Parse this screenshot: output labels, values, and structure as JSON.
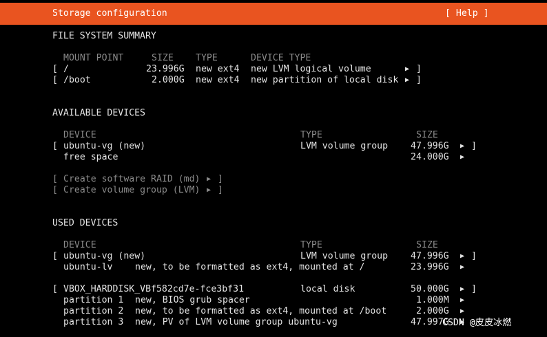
{
  "header": {
    "title": "Storage configuration",
    "help": "[ Help ]",
    "color": "#e95420"
  },
  "fs_summary": {
    "heading": "FILE SYSTEM SUMMARY",
    "columns": [
      "MOUNT POINT",
      "SIZE",
      "TYPE",
      "DEVICE TYPE"
    ],
    "rows": [
      {
        "mount": "/",
        "size": "23.996G",
        "type": "new ext4",
        "device_type": "new LVM logical volume"
      },
      {
        "mount": "/boot",
        "size": "2.000G",
        "type": "new ext4",
        "device_type": "new partition of local disk"
      }
    ]
  },
  "available": {
    "heading": "AVAILABLE DEVICES",
    "columns": [
      "DEVICE",
      "TYPE",
      "SIZE"
    ],
    "vg_row": {
      "device": "ubuntu-vg (new)",
      "type": "LVM volume group",
      "size": "47.996G"
    },
    "free_row": {
      "label": "free space",
      "size": "24.000G"
    },
    "create_raid": "Create software RAID (md)",
    "create_vg": "Create volume group (LVM)"
  },
  "used": {
    "heading": "USED DEVICES",
    "columns": [
      "DEVICE",
      "TYPE",
      "SIZE"
    ],
    "vg_row": {
      "device": "ubuntu-vg (new)",
      "type": "LVM volume group",
      "size": "47.996G"
    },
    "lv_row": {
      "name": "ubuntu-lv",
      "desc": "new, to be formatted as ext4, mounted at /",
      "size": "23.996G"
    },
    "disk_row": {
      "device": "VBOX_HARDDISK_VBf582cd7e-fce3bf31",
      "type": "local disk",
      "size": "50.000G"
    },
    "partitions": [
      {
        "name": "partition 1",
        "desc": "new, BIOS grub spacer",
        "size": "1.000M"
      },
      {
        "name": "partition 2",
        "desc": "new, to be formatted as ext4, mounted at /boot",
        "size": "2.000G"
      },
      {
        "name": "partition 3",
        "desc": "new, PV of LVM volume group ubuntu-vg",
        "size": "47.997G"
      }
    ]
  },
  "ui": {
    "open_bracket": "[",
    "close_bracket": "]",
    "arrow": "▶",
    "watermark": "CSDN @皮皮冰燃"
  }
}
